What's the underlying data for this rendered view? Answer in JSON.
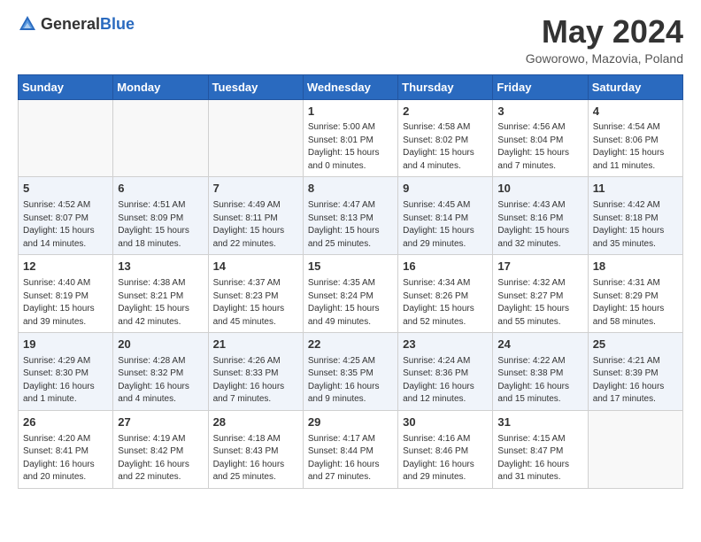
{
  "header": {
    "logo_general": "General",
    "logo_blue": "Blue",
    "month_title": "May 2024",
    "location": "Goworowo, Mazovia, Poland"
  },
  "days_of_week": [
    "Sunday",
    "Monday",
    "Tuesday",
    "Wednesday",
    "Thursday",
    "Friday",
    "Saturday"
  ],
  "weeks": [
    [
      {
        "day": "",
        "info": ""
      },
      {
        "day": "",
        "info": ""
      },
      {
        "day": "",
        "info": ""
      },
      {
        "day": "1",
        "info": "Sunrise: 5:00 AM\nSunset: 8:01 PM\nDaylight: 15 hours\nand 0 minutes."
      },
      {
        "day": "2",
        "info": "Sunrise: 4:58 AM\nSunset: 8:02 PM\nDaylight: 15 hours\nand 4 minutes."
      },
      {
        "day": "3",
        "info": "Sunrise: 4:56 AM\nSunset: 8:04 PM\nDaylight: 15 hours\nand 7 minutes."
      },
      {
        "day": "4",
        "info": "Sunrise: 4:54 AM\nSunset: 8:06 PM\nDaylight: 15 hours\nand 11 minutes."
      }
    ],
    [
      {
        "day": "5",
        "info": "Sunrise: 4:52 AM\nSunset: 8:07 PM\nDaylight: 15 hours\nand 14 minutes."
      },
      {
        "day": "6",
        "info": "Sunrise: 4:51 AM\nSunset: 8:09 PM\nDaylight: 15 hours\nand 18 minutes."
      },
      {
        "day": "7",
        "info": "Sunrise: 4:49 AM\nSunset: 8:11 PM\nDaylight: 15 hours\nand 22 minutes."
      },
      {
        "day": "8",
        "info": "Sunrise: 4:47 AM\nSunset: 8:13 PM\nDaylight: 15 hours\nand 25 minutes."
      },
      {
        "day": "9",
        "info": "Sunrise: 4:45 AM\nSunset: 8:14 PM\nDaylight: 15 hours\nand 29 minutes."
      },
      {
        "day": "10",
        "info": "Sunrise: 4:43 AM\nSunset: 8:16 PM\nDaylight: 15 hours\nand 32 minutes."
      },
      {
        "day": "11",
        "info": "Sunrise: 4:42 AM\nSunset: 8:18 PM\nDaylight: 15 hours\nand 35 minutes."
      }
    ],
    [
      {
        "day": "12",
        "info": "Sunrise: 4:40 AM\nSunset: 8:19 PM\nDaylight: 15 hours\nand 39 minutes."
      },
      {
        "day": "13",
        "info": "Sunrise: 4:38 AM\nSunset: 8:21 PM\nDaylight: 15 hours\nand 42 minutes."
      },
      {
        "day": "14",
        "info": "Sunrise: 4:37 AM\nSunset: 8:23 PM\nDaylight: 15 hours\nand 45 minutes."
      },
      {
        "day": "15",
        "info": "Sunrise: 4:35 AM\nSunset: 8:24 PM\nDaylight: 15 hours\nand 49 minutes."
      },
      {
        "day": "16",
        "info": "Sunrise: 4:34 AM\nSunset: 8:26 PM\nDaylight: 15 hours\nand 52 minutes."
      },
      {
        "day": "17",
        "info": "Sunrise: 4:32 AM\nSunset: 8:27 PM\nDaylight: 15 hours\nand 55 minutes."
      },
      {
        "day": "18",
        "info": "Sunrise: 4:31 AM\nSunset: 8:29 PM\nDaylight: 15 hours\nand 58 minutes."
      }
    ],
    [
      {
        "day": "19",
        "info": "Sunrise: 4:29 AM\nSunset: 8:30 PM\nDaylight: 16 hours\nand 1 minute."
      },
      {
        "day": "20",
        "info": "Sunrise: 4:28 AM\nSunset: 8:32 PM\nDaylight: 16 hours\nand 4 minutes."
      },
      {
        "day": "21",
        "info": "Sunrise: 4:26 AM\nSunset: 8:33 PM\nDaylight: 16 hours\nand 7 minutes."
      },
      {
        "day": "22",
        "info": "Sunrise: 4:25 AM\nSunset: 8:35 PM\nDaylight: 16 hours\nand 9 minutes."
      },
      {
        "day": "23",
        "info": "Sunrise: 4:24 AM\nSunset: 8:36 PM\nDaylight: 16 hours\nand 12 minutes."
      },
      {
        "day": "24",
        "info": "Sunrise: 4:22 AM\nSunset: 8:38 PM\nDaylight: 16 hours\nand 15 minutes."
      },
      {
        "day": "25",
        "info": "Sunrise: 4:21 AM\nSunset: 8:39 PM\nDaylight: 16 hours\nand 17 minutes."
      }
    ],
    [
      {
        "day": "26",
        "info": "Sunrise: 4:20 AM\nSunset: 8:41 PM\nDaylight: 16 hours\nand 20 minutes."
      },
      {
        "day": "27",
        "info": "Sunrise: 4:19 AM\nSunset: 8:42 PM\nDaylight: 16 hours\nand 22 minutes."
      },
      {
        "day": "28",
        "info": "Sunrise: 4:18 AM\nSunset: 8:43 PM\nDaylight: 16 hours\nand 25 minutes."
      },
      {
        "day": "29",
        "info": "Sunrise: 4:17 AM\nSunset: 8:44 PM\nDaylight: 16 hours\nand 27 minutes."
      },
      {
        "day": "30",
        "info": "Sunrise: 4:16 AM\nSunset: 8:46 PM\nDaylight: 16 hours\nand 29 minutes."
      },
      {
        "day": "31",
        "info": "Sunrise: 4:15 AM\nSunset: 8:47 PM\nDaylight: 16 hours\nand 31 minutes."
      },
      {
        "day": "",
        "info": ""
      }
    ]
  ]
}
